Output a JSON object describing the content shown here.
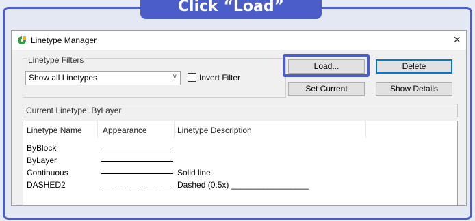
{
  "instruction_banner": "Click “Load”",
  "window": {
    "title": "Linetype Manager",
    "close_glyph": "×"
  },
  "filters": {
    "group_label": "Linetype Filters",
    "selected_option": "Show all Linetypes",
    "invert_filter_label": "Invert Filter"
  },
  "buttons": {
    "load": "Load...",
    "delete": "Delete",
    "set_current": "Set Current",
    "show_details": "Show Details"
  },
  "current_linetype": "Current Linetype:  ByLayer",
  "table": {
    "columns": [
      "Linetype Name",
      "Appearance",
      "Linetype Description"
    ],
    "rows": [
      {
        "name": "ByBlock",
        "appearance": "solid",
        "description": ""
      },
      {
        "name": "ByLayer",
        "appearance": "solid",
        "description": ""
      },
      {
        "name": "Continuous",
        "appearance": "solid",
        "description": "Solid line"
      },
      {
        "name": "DASHED2",
        "appearance": "dashed",
        "description": "Dashed (0.5x) _________________"
      }
    ]
  },
  "icons": {
    "app": "linetype-manager-icon",
    "close": "close-icon",
    "dropdown": "chevron-down-icon"
  },
  "colors": {
    "highlight": "#4a5dc9",
    "app_icon_primary": "#2e9e3e",
    "app_icon_secondary": "#f2b705"
  }
}
